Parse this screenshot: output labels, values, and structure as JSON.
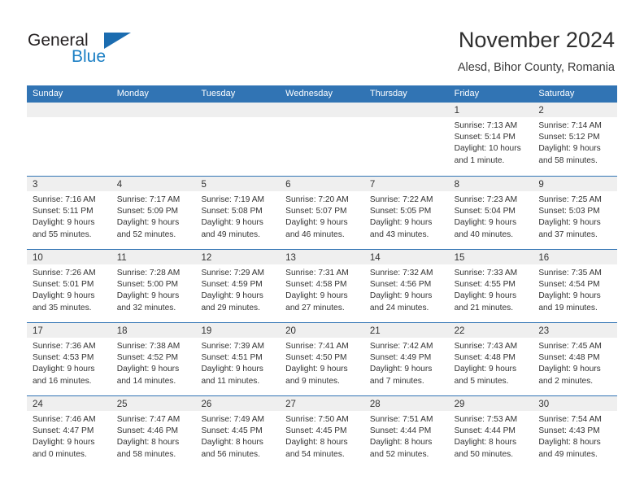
{
  "brand": {
    "name_part1": "General",
    "name_part2": "Blue",
    "accent_color": "#1b7fc4",
    "triangle_color": "#1b6cb0"
  },
  "header": {
    "month_title": "November 2024",
    "location": "Alesd, Bihor County, Romania"
  },
  "theme": {
    "header_blue": "#3174b4",
    "date_band_gray": "#efefef",
    "text_color": "#333333"
  },
  "weekdays": [
    "Sunday",
    "Monday",
    "Tuesday",
    "Wednesday",
    "Thursday",
    "Friday",
    "Saturday"
  ],
  "weeks": [
    [
      {
        "day": "",
        "lines": []
      },
      {
        "day": "",
        "lines": []
      },
      {
        "day": "",
        "lines": []
      },
      {
        "day": "",
        "lines": []
      },
      {
        "day": "",
        "lines": []
      },
      {
        "day": "1",
        "lines": [
          "Sunrise: 7:13 AM",
          "Sunset: 5:14 PM",
          "Daylight: 10 hours",
          "and 1 minute."
        ]
      },
      {
        "day": "2",
        "lines": [
          "Sunrise: 7:14 AM",
          "Sunset: 5:12 PM",
          "Daylight: 9 hours",
          "and 58 minutes."
        ]
      }
    ],
    [
      {
        "day": "3",
        "lines": [
          "Sunrise: 7:16 AM",
          "Sunset: 5:11 PM",
          "Daylight: 9 hours",
          "and 55 minutes."
        ]
      },
      {
        "day": "4",
        "lines": [
          "Sunrise: 7:17 AM",
          "Sunset: 5:09 PM",
          "Daylight: 9 hours",
          "and 52 minutes."
        ]
      },
      {
        "day": "5",
        "lines": [
          "Sunrise: 7:19 AM",
          "Sunset: 5:08 PM",
          "Daylight: 9 hours",
          "and 49 minutes."
        ]
      },
      {
        "day": "6",
        "lines": [
          "Sunrise: 7:20 AM",
          "Sunset: 5:07 PM",
          "Daylight: 9 hours",
          "and 46 minutes."
        ]
      },
      {
        "day": "7",
        "lines": [
          "Sunrise: 7:22 AM",
          "Sunset: 5:05 PM",
          "Daylight: 9 hours",
          "and 43 minutes."
        ]
      },
      {
        "day": "8",
        "lines": [
          "Sunrise: 7:23 AM",
          "Sunset: 5:04 PM",
          "Daylight: 9 hours",
          "and 40 minutes."
        ]
      },
      {
        "day": "9",
        "lines": [
          "Sunrise: 7:25 AM",
          "Sunset: 5:03 PM",
          "Daylight: 9 hours",
          "and 37 minutes."
        ]
      }
    ],
    [
      {
        "day": "10",
        "lines": [
          "Sunrise: 7:26 AM",
          "Sunset: 5:01 PM",
          "Daylight: 9 hours",
          "and 35 minutes."
        ]
      },
      {
        "day": "11",
        "lines": [
          "Sunrise: 7:28 AM",
          "Sunset: 5:00 PM",
          "Daylight: 9 hours",
          "and 32 minutes."
        ]
      },
      {
        "day": "12",
        "lines": [
          "Sunrise: 7:29 AM",
          "Sunset: 4:59 PM",
          "Daylight: 9 hours",
          "and 29 minutes."
        ]
      },
      {
        "day": "13",
        "lines": [
          "Sunrise: 7:31 AM",
          "Sunset: 4:58 PM",
          "Daylight: 9 hours",
          "and 27 minutes."
        ]
      },
      {
        "day": "14",
        "lines": [
          "Sunrise: 7:32 AM",
          "Sunset: 4:56 PM",
          "Daylight: 9 hours",
          "and 24 minutes."
        ]
      },
      {
        "day": "15",
        "lines": [
          "Sunrise: 7:33 AM",
          "Sunset: 4:55 PM",
          "Daylight: 9 hours",
          "and 21 minutes."
        ]
      },
      {
        "day": "16",
        "lines": [
          "Sunrise: 7:35 AM",
          "Sunset: 4:54 PM",
          "Daylight: 9 hours",
          "and 19 minutes."
        ]
      }
    ],
    [
      {
        "day": "17",
        "lines": [
          "Sunrise: 7:36 AM",
          "Sunset: 4:53 PM",
          "Daylight: 9 hours",
          "and 16 minutes."
        ]
      },
      {
        "day": "18",
        "lines": [
          "Sunrise: 7:38 AM",
          "Sunset: 4:52 PM",
          "Daylight: 9 hours",
          "and 14 minutes."
        ]
      },
      {
        "day": "19",
        "lines": [
          "Sunrise: 7:39 AM",
          "Sunset: 4:51 PM",
          "Daylight: 9 hours",
          "and 11 minutes."
        ]
      },
      {
        "day": "20",
        "lines": [
          "Sunrise: 7:41 AM",
          "Sunset: 4:50 PM",
          "Daylight: 9 hours",
          "and 9 minutes."
        ]
      },
      {
        "day": "21",
        "lines": [
          "Sunrise: 7:42 AM",
          "Sunset: 4:49 PM",
          "Daylight: 9 hours",
          "and 7 minutes."
        ]
      },
      {
        "day": "22",
        "lines": [
          "Sunrise: 7:43 AM",
          "Sunset: 4:48 PM",
          "Daylight: 9 hours",
          "and 5 minutes."
        ]
      },
      {
        "day": "23",
        "lines": [
          "Sunrise: 7:45 AM",
          "Sunset: 4:48 PM",
          "Daylight: 9 hours",
          "and 2 minutes."
        ]
      }
    ],
    [
      {
        "day": "24",
        "lines": [
          "Sunrise: 7:46 AM",
          "Sunset: 4:47 PM",
          "Daylight: 9 hours",
          "and 0 minutes."
        ]
      },
      {
        "day": "25",
        "lines": [
          "Sunrise: 7:47 AM",
          "Sunset: 4:46 PM",
          "Daylight: 8 hours",
          "and 58 minutes."
        ]
      },
      {
        "day": "26",
        "lines": [
          "Sunrise: 7:49 AM",
          "Sunset: 4:45 PM",
          "Daylight: 8 hours",
          "and 56 minutes."
        ]
      },
      {
        "day": "27",
        "lines": [
          "Sunrise: 7:50 AM",
          "Sunset: 4:45 PM",
          "Daylight: 8 hours",
          "and 54 minutes."
        ]
      },
      {
        "day": "28",
        "lines": [
          "Sunrise: 7:51 AM",
          "Sunset: 4:44 PM",
          "Daylight: 8 hours",
          "and 52 minutes."
        ]
      },
      {
        "day": "29",
        "lines": [
          "Sunrise: 7:53 AM",
          "Sunset: 4:44 PM",
          "Daylight: 8 hours",
          "and 50 minutes."
        ]
      },
      {
        "day": "30",
        "lines": [
          "Sunrise: 7:54 AM",
          "Sunset: 4:43 PM",
          "Daylight: 8 hours",
          "and 49 minutes."
        ]
      }
    ]
  ]
}
